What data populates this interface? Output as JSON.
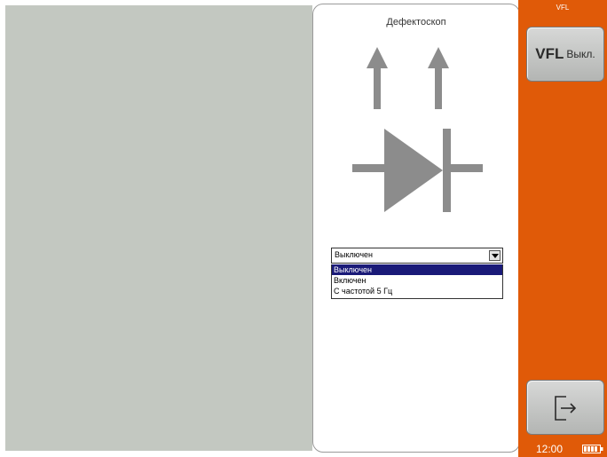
{
  "device_panel": {
    "title": "Дефектоскоп"
  },
  "mode_select": {
    "current_value": "Выключен",
    "options": [
      "Выключен",
      "Включен",
      "С частотой 5 Гц"
    ],
    "highlighted_index": 0
  },
  "right_panel": {
    "title": "VFL",
    "vfl_button": {
      "label": "VFL",
      "state": "Выкл."
    },
    "exit_icon": "exit-icon"
  },
  "status": {
    "time": "12:00",
    "battery_icon": "battery-icon"
  },
  "colors": {
    "accent": "#e05a08",
    "left_pane": "#c3c8c1",
    "highlight": "#1a1a78",
    "diagram_gray": "#8c8c8c"
  }
}
